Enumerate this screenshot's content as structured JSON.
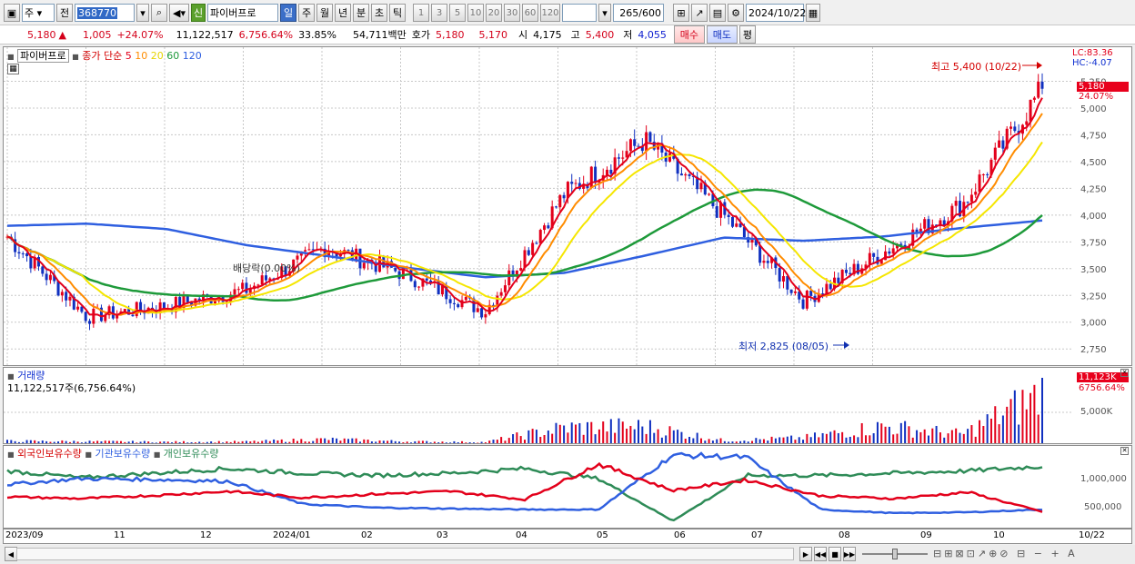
{
  "toolbar": {
    "market": "주",
    "prev": "전",
    "code": "368770",
    "new_badge": "신",
    "stock_name": "파이버프로",
    "periods": [
      "일",
      "주",
      "월",
      "년",
      "분",
      "초",
      "틱"
    ],
    "intervals": [
      "1",
      "3",
      "5",
      "10",
      "20",
      "30",
      "60",
      "120"
    ],
    "count": "265",
    "count_total": "/600",
    "date": "2024/10/22"
  },
  "quote": {
    "price": "5,180",
    "change": "1,005",
    "change_pct": "+24.07%",
    "volume": "11,122,517",
    "volume_pct": "6,756.64%",
    "turnover": "33.85%",
    "amount": "54,711백만",
    "ask_label": "호가",
    "ask": "5,180",
    "bid": "5,170",
    "open_label": "시",
    "open": "4,175",
    "high_label": "고",
    "high": "5,400",
    "low_label": "저",
    "low": "4,055",
    "buy": "매수",
    "sell": "매도",
    "eval": "평"
  },
  "main_chart": {
    "stock_label": "파이버프로",
    "ma_label": "종가 단순",
    "ma_periods": [
      "5",
      "10",
      "20",
      "60",
      "120"
    ],
    "ma_colors": [
      "#e3001b",
      "#ff8c00",
      "#f5e600",
      "#1e9a3a",
      "#2f5fe0"
    ],
    "lc": "LC:83.36",
    "hc": "HC:-4.07",
    "price_tag": "5,180",
    "pct_tag": "24.07%",
    "high_note": "최고 5,400 (10/22)",
    "low_note": "최저 2,825 (08/05)",
    "dividend_note": "배당락(0.00%)",
    "y_ticks": [
      "5,250",
      "5,000",
      "4,750",
      "4,500",
      "4,250",
      "4,000",
      "3,750",
      "3,500",
      "3,250",
      "3,000",
      "2,750"
    ]
  },
  "volume_chart": {
    "title": "거래량",
    "summary": "11,122,517주(6,756.64%)",
    "tag": "11,123K",
    "tag_pct": "6756.64%",
    "y_tick": "5,000K"
  },
  "holding_chart": {
    "series_labels": [
      "외국인보유수량",
      "기관보유수량",
      "개인보유수량"
    ],
    "series_colors": [
      "#e3001b",
      "#2f5fe0",
      "#2e8b57"
    ],
    "y_ticks": [
      "1,000,000",
      "500,000"
    ]
  },
  "x_axis": {
    "labels": [
      "2023/09",
      "11",
      "12",
      "2024/01",
      "02",
      "03",
      "04",
      "05",
      "06",
      "07",
      "08",
      "09",
      "10"
    ],
    "last": "10/22"
  },
  "chart_data": [
    {
      "type": "line",
      "title": "파이버프로 종가",
      "x": [
        "2023/09",
        "11",
        "12",
        "2024/01",
        "02",
        "03",
        "04",
        "05",
        "06",
        "07",
        "08",
        "09",
        "10",
        "10/22"
      ],
      "series": [
        {
          "name": "종가",
          "values": [
            3800,
            3050,
            3150,
            3300,
            3700,
            3450,
            3100,
            4200,
            4700,
            4000,
            3200,
            3650,
            4100,
            5180
          ]
        },
        {
          "name": "120",
          "values": [
            3900,
            3920,
            3870,
            3720,
            3620,
            3510,
            3420,
            3460,
            3620,
            3790,
            3760,
            3800,
            3880,
            3950
          ]
        }
      ],
      "ylim": [
        2750,
        5400
      ]
    },
    {
      "type": "bar",
      "title": "거래량",
      "categories": [
        "2023/09",
        "11",
        "12",
        "2024/01",
        "02",
        "03",
        "04",
        "05",
        "06",
        "07",
        "08",
        "09",
        "10",
        "10/22"
      ],
      "values": [
        500,
        400,
        300,
        350,
        900,
        400,
        250,
        3500,
        3800,
        600,
        1200,
        3800,
        2000,
        11123
      ]
    }
  ]
}
